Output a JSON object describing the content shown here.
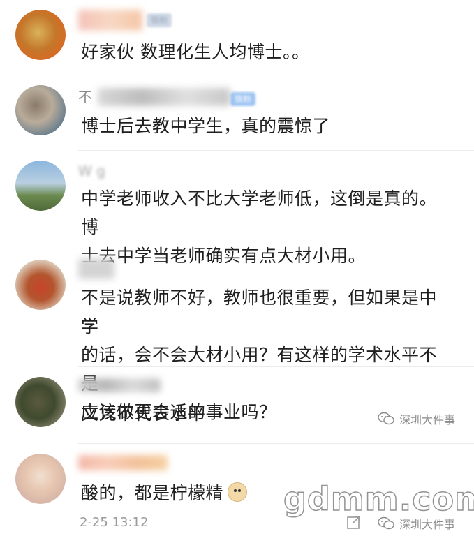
{
  "comments": [
    {
      "name": "",
      "badge": "铁粉",
      "text": "好家伙 数理化生人均博士。。"
    },
    {
      "name": "不",
      "badge": "铁粉",
      "text": "博士后去教中学生，真的震惊了"
    },
    {
      "name": "W                g",
      "badge": "",
      "text_lines": [
        "中学老师收入不比大学老师低，这倒是真的。博",
        "士去中学当老师确实有点大材小用。"
      ]
    },
    {
      "name": "",
      "badge": "",
      "text_lines": [
        "不是说教师不好，教师也很重要，但如果是中学",
        "的话，会不会大材小用？有这样的学术水平不是",
        "应该做更合适的事业吗？"
      ]
    },
    {
      "name": "",
      "badge": "",
      "text": "文凭不代表水平"
    },
    {
      "name": "",
      "badge": "",
      "text": "酸的，都是柠檬精",
      "emoji": "doge-emoji"
    }
  ],
  "timestamp": "2-25 13:12",
  "watermarks": {
    "source_1": "深圳大件事",
    "source_2": "深圳大件事",
    "site": "gdmm.com"
  },
  "icons": {
    "share": "share-icon",
    "wechat": "wechat-icon"
  },
  "colors": {
    "text": "#1f1f1f",
    "meta": "#9a9a9a",
    "divider": "#ececec",
    "badge": "#9ec4f2"
  }
}
